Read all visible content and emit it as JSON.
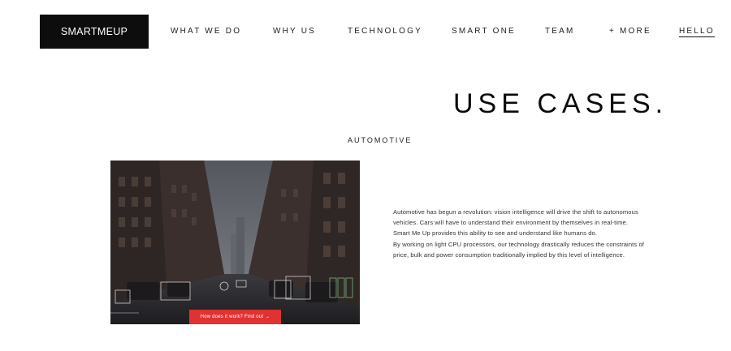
{
  "brand": {
    "name": "SMARTMEUP"
  },
  "nav": {
    "items": [
      {
        "label": "WHAT WE DO"
      },
      {
        "label": "WHY US"
      },
      {
        "label": "TECHNOLOGY"
      },
      {
        "label": "SMART ONE"
      },
      {
        "label": "TEAM"
      },
      {
        "label": "+ MORE"
      },
      {
        "label": "HELLO",
        "active": true
      }
    ]
  },
  "page": {
    "title": "USE CASES."
  },
  "section": {
    "label": "AUTOMOTIVE",
    "cta_label": "How does it work? Find out →",
    "paragraphs": [
      "Automotive has begun a revolution: vision intelligence will drive the shift to autonomous vehicles. Cars will have to understand their environment by themselves in real-time. Smart Me Up provides this ability to see and understand like humans do.",
      "By working on light CPU processors, our technology drastically reduces the constraints of price, bulk and power consumption traditionally implied by this level of intelligence."
    ]
  },
  "colors": {
    "accent": "#e03232",
    "dark": "#0d0d0d"
  }
}
